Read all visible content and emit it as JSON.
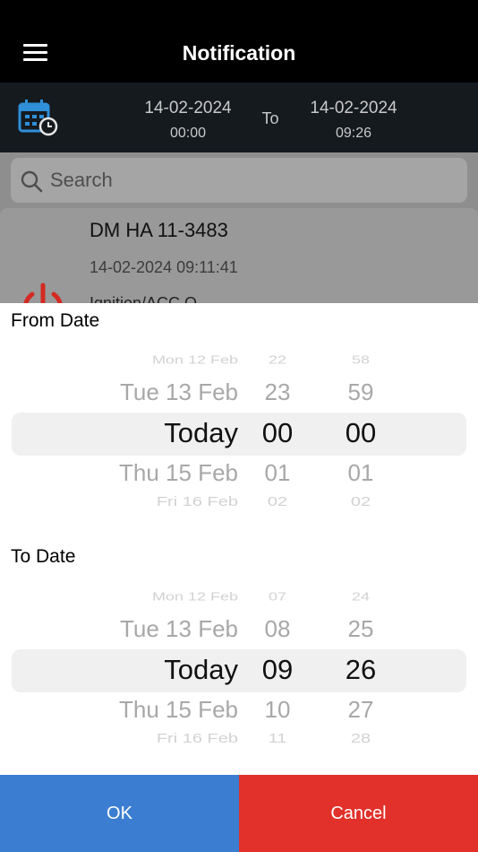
{
  "header": {
    "title": "Notification"
  },
  "date_range": {
    "from_date": "14-02-2024",
    "from_time": "00:00",
    "to_label": "To",
    "to_date": "14-02-2024",
    "to_time": "09:26"
  },
  "search": {
    "placeholder": "Search"
  },
  "notification": {
    "title": "DM HA 11-3483",
    "timestamp": "14-02-2024 09:11:41",
    "subtitle": "Ignition/ACC O..."
  },
  "from_picker": {
    "label": "From Date",
    "dates": [
      "Mon 12 Feb",
      "Tue 13 Feb",
      "Today",
      "Thu 15 Feb",
      "Fri 16 Feb"
    ],
    "hours": [
      "22",
      "23",
      "00",
      "01",
      "02"
    ],
    "minutes": [
      "58",
      "59",
      "00",
      "01",
      "02"
    ]
  },
  "to_picker": {
    "label": "To Date",
    "dates": [
      "Mon 12 Feb",
      "Tue 13 Feb",
      "Today",
      "Thu 15 Feb",
      "Fri 16 Feb"
    ],
    "hours": [
      "07",
      "08",
      "09",
      "10",
      "11"
    ],
    "minutes": [
      "24",
      "25",
      "26",
      "27",
      "28"
    ]
  },
  "buttons": {
    "ok": "OK",
    "cancel": "Cancel"
  },
  "colors": {
    "ok": "#3b7ed1",
    "cancel": "#e2312a",
    "calendar_icon": "#2f8fd8",
    "power_icon": "#d42a23"
  }
}
